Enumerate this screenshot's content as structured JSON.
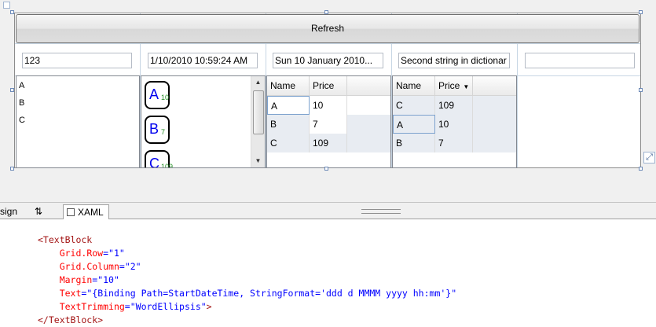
{
  "designer": {
    "refresh_label": "Refresh",
    "textboxes": [
      "123",
      "1/10/2010 10:59:24 AM",
      "Sun 10 January 2010...",
      "Second string in dictionar",
      ""
    ],
    "list1": [
      "A",
      "B",
      "C"
    ],
    "cards": [
      {
        "letter": "A",
        "number": "10"
      },
      {
        "letter": "B",
        "number": "7"
      },
      {
        "letter": "C",
        "number": "109"
      }
    ],
    "grid1": {
      "headers": [
        "Name",
        "Price"
      ],
      "rows": [
        [
          "A",
          "10"
        ],
        [
          "B",
          "7"
        ],
        [
          "C",
          "109"
        ]
      ]
    },
    "grid2": {
      "headers": [
        "Name",
        "Price"
      ],
      "rows": [
        [
          "C",
          "109"
        ],
        [
          "A",
          "10"
        ],
        [
          "B",
          "7"
        ]
      ]
    }
  },
  "tabs": {
    "design": "sign",
    "swap": "⇅",
    "xaml": "XAML"
  },
  "code": {
    "open_tag": "<TextBlock",
    "attrs": [
      {
        "name": "Grid.Row",
        "value": "\"1\""
      },
      {
        "name": "Grid.Column",
        "value": "\"2\""
      },
      {
        "name": "Margin",
        "value": "\"10\""
      },
      {
        "name": "Text",
        "value": "\"{Binding Path=StartDateTime, StringFormat='ddd d MMMM yyyy hh:mm'}\""
      },
      {
        "name": "TextTrimming",
        "value": "\"WordEllipsis\""
      }
    ],
    "close_tag": "</TextBlock>"
  },
  "colors": {
    "tag": "#a31515",
    "attribute": "#ff0000",
    "value": "#0000ff",
    "card_letter": "#0000ee",
    "card_number": "#1f8a1f"
  }
}
